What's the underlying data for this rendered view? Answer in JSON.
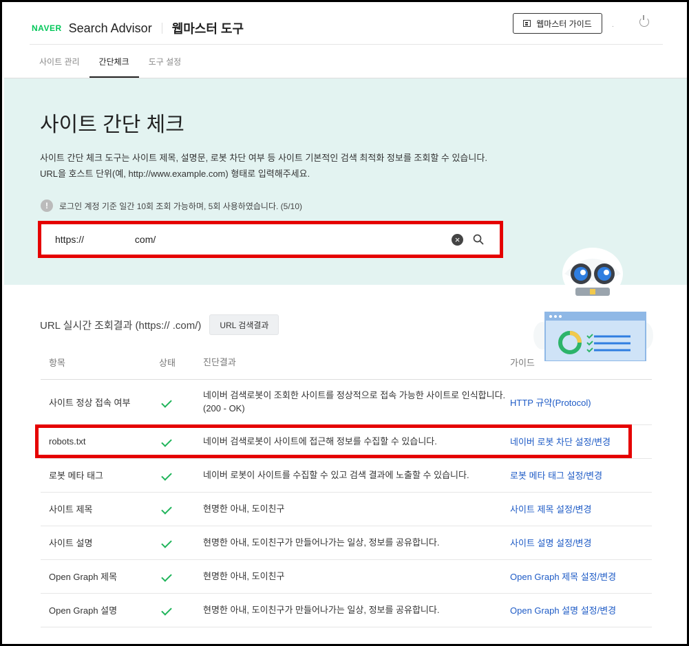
{
  "header": {
    "naver": "NAVER",
    "brand": "Search Advisor",
    "tool_title": "웹마스터 도구",
    "guide_button": "웹마스터 가이드",
    "user_dot": "."
  },
  "tabs": [
    {
      "label": "사이트 관리",
      "active": false
    },
    {
      "label": "간단체크",
      "active": true
    },
    {
      "label": "도구 설정",
      "active": false
    }
  ],
  "hero": {
    "title": "사이트 간단 체크",
    "desc_line1": "사이트 간단 체크 도구는 사이트 제목, 설명문, 로봇 차단 여부 등 사이트 기본적인 검색 최적화 정보를 조회할 수 있습니다.",
    "desc_line2": "URL을 호스트 단위(예, http://www.example.com) 형태로 입력해주세요.",
    "notice": "로그인 계정 기준 일간 10회 조회 가능하며, 5회 사용하였습니다. (5/10)",
    "notice_icon": "!",
    "search_value": "https://                   com/",
    "clear_icon": "×"
  },
  "results": {
    "title": "URL 실시간 조회결과 (https://              .com/)",
    "url_button": "URL 검색결과",
    "columns": [
      "항목",
      "상태",
      "진단결과",
      "가이드"
    ],
    "rows": [
      {
        "item": "사이트 정상 접속 여부",
        "status": "ok",
        "result": "네이버 검색로봇이 조회한 사이트를 정상적으로 접속 가능한 사이트로 인식합니다. (200 - OK)",
        "guide": "HTTP 규약(Protocol)"
      },
      {
        "item": "robots.txt",
        "status": "ok",
        "result": "네이버 검색로봇이 사이트에 접근해 정보를 수집할 수 있습니다.",
        "guide": "네이버 로봇 차단 설정/변경"
      },
      {
        "item": "로봇 메타 태그",
        "status": "ok",
        "result": "네이버 로봇이 사이트를 수집할 수 있고 검색 결과에 노출할 수 있습니다.",
        "guide": "로봇 메타 태그 설정/변경"
      },
      {
        "item": "사이트 제목",
        "status": "ok",
        "result": "현명한 아내, 도이친구",
        "guide": "사이트 제목 설정/변경"
      },
      {
        "item": "사이트 설명",
        "status": "ok",
        "result": "현명한 아내, 도이친구가 만들어나가는 일상, 정보를 공유합니다.",
        "guide": "사이트 설명 설정/변경"
      },
      {
        "item": "Open Graph 제목",
        "status": "ok",
        "result": "현명한 아내, 도이친구",
        "guide": "Open Graph 제목 설정/변경"
      },
      {
        "item": "Open Graph 설명",
        "status": "ok",
        "result": "현명한 아내, 도이친구가 만들어나가는 일상, 정보를 공유합니다.",
        "guide": "Open Graph 설명 설정/변경"
      }
    ]
  },
  "colors": {
    "naver_green": "#03c75a",
    "hero_bg": "#e3f3f1",
    "highlight_red": "#e50000",
    "check_green": "#1fb45a",
    "link_blue": "#1e5bc6"
  }
}
